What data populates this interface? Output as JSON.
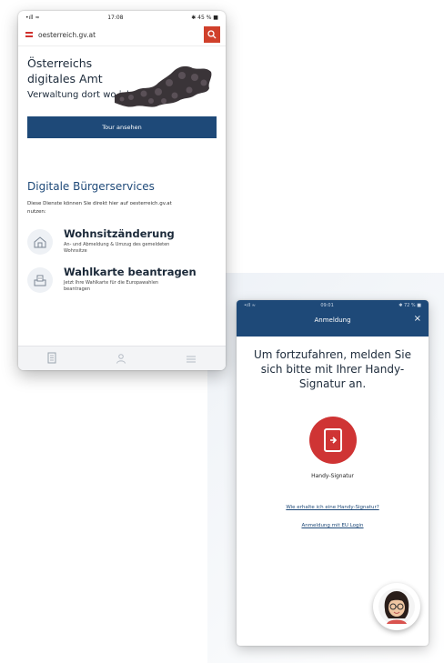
{
  "phone1": {
    "status": {
      "carrier": "•ıll ≈",
      "time": "17:08",
      "battery": "✱ 45 % ■"
    },
    "url": "oesterreich.gv.at",
    "hero": {
      "title": "Österreichs digitales Amt",
      "subtitle": "Verwaltung dort wo ich bin.",
      "button": "Tour ansehen"
    },
    "services": {
      "title": "Digitale Bürgerservices",
      "description": "Diese Dienste können Sie direkt hier auf oesterreich.gv.at nutzen:",
      "items": [
        {
          "title": "Wohnsitzänderung",
          "desc": "An- und Abmeldung & Umzug des gemeldeten Wohnsitze",
          "icon": "house-icon"
        },
        {
          "title": "Wahlkarte beantragen",
          "desc": "Jetzt Ihre Wahlkarte für die Europawahlen beantragen",
          "icon": "ballot-icon"
        }
      ]
    },
    "bottom_nav": [
      "document-icon",
      "person-icon",
      "menu-icon"
    ]
  },
  "phone2": {
    "status": {
      "carrier": "•ıll ≈",
      "time": "09:01",
      "battery": "✱ 72 % ■"
    },
    "title": "Anmeldung",
    "close": "×",
    "heading": "Um fortzufahren, melden Sie sich bitte mit Ihrer Handy-Signatur an.",
    "handy_label": "Handy-Signatur",
    "link1": "Wie erhalte ich eine Handy-Signatur?",
    "link2": "Anmeldung mit EU Login"
  },
  "colors": {
    "primary": "#1e4978",
    "accent_red": "#cf3434",
    "search_red": "#d0402b"
  }
}
